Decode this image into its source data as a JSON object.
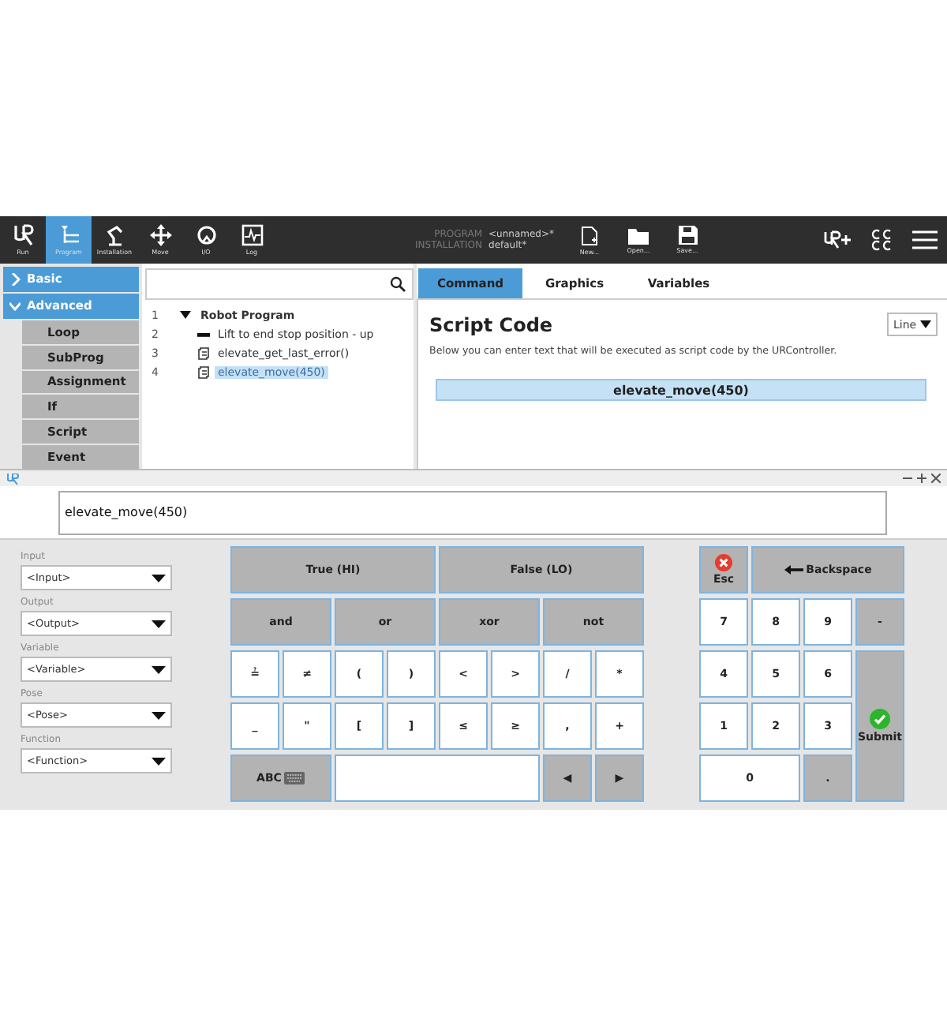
{
  "toolbar": {
    "nav": [
      {
        "label": "Run",
        "kind": "logo",
        "selected": false
      },
      {
        "label": "Program",
        "kind": "program",
        "selected": true
      },
      {
        "label": "Installation",
        "kind": "arm",
        "selected": false
      },
      {
        "label": "Move",
        "kind": "move",
        "selected": false
      },
      {
        "label": "I/O",
        "kind": "io",
        "selected": false
      },
      {
        "label": "Log",
        "kind": "log",
        "selected": false
      }
    ],
    "program": {
      "label": "PROGRAM",
      "value": "<unnamed>*"
    },
    "installation": {
      "label": "INSTALLATION",
      "value": "default*"
    },
    "file_buttons": [
      {
        "label": "New...",
        "kind": "new"
      },
      {
        "label": "Open...",
        "kind": "open"
      },
      {
        "label": "Save...",
        "kind": "save"
      }
    ]
  },
  "sidebar": {
    "sections": [
      {
        "label": "Basic",
        "expanded": false
      },
      {
        "label": "Advanced",
        "expanded": true,
        "items": [
          "Loop",
          "SubProg",
          "Assignment",
          "If",
          "Script",
          "Event"
        ]
      }
    ]
  },
  "tree": {
    "nodes": [
      {
        "number": "1",
        "label": "Robot Program",
        "kind": "root",
        "expanded": true,
        "selected": false,
        "children": [
          {
            "number": "2",
            "label": "Lift to end stop position - up",
            "kind": "bar",
            "selected": false
          },
          {
            "number": "3",
            "label": "elevate_get_last_error()",
            "kind": "script",
            "selected": false
          },
          {
            "number": "4",
            "label": "elevate_move(450)",
            "kind": "script",
            "selected": true
          }
        ]
      }
    ]
  },
  "command_panel": {
    "tabs": [
      {
        "label": "Command",
        "selected": true
      },
      {
        "label": "Graphics",
        "selected": false
      },
      {
        "label": "Variables",
        "selected": false
      }
    ],
    "title": "Script Code",
    "mode": "Line",
    "description": "Below you can enter text that will be executed as script code by the URController.",
    "code_line": "elevate_move(450)"
  },
  "dialog": {
    "expression": "elevate_move(450)",
    "selectors": [
      {
        "label": "Input",
        "value": "<Input>"
      },
      {
        "label": "Output",
        "value": "<Output>"
      },
      {
        "label": "Variable",
        "value": "<Variable>"
      },
      {
        "label": "Pose",
        "value": "<Pose>"
      },
      {
        "label": "Function",
        "value": "<Function>"
      }
    ],
    "keypad": [
      [
        {
          "label": "True (HI)",
          "kind": "value"
        },
        {
          "label": "False (LO)",
          "kind": "value"
        }
      ],
      [
        {
          "label": "and",
          "kind": "logic"
        },
        {
          "label": "or",
          "kind": "logic"
        },
        {
          "label": "xor",
          "kind": "logic"
        },
        {
          "label": "not",
          "kind": "logic"
        }
      ],
      [
        {
          "label": "≟",
          "kind": "symbol"
        },
        {
          "label": "≠",
          "kind": "symbol"
        },
        {
          "label": "(",
          "kind": "symbol"
        },
        {
          "label": ")",
          "kind": "symbol"
        },
        {
          "label": "<",
          "kind": "symbol"
        },
        {
          "label": ">",
          "kind": "symbol"
        },
        {
          "label": "/",
          "kind": "symbol"
        },
        {
          "label": "*",
          "kind": "symbol"
        }
      ],
      [
        {
          "label": "_",
          "kind": "symbol"
        },
        {
          "label": "\"",
          "kind": "symbol"
        },
        {
          "label": "[",
          "kind": "symbol"
        },
        {
          "label": "]",
          "kind": "symbol"
        },
        {
          "label": "≤",
          "kind": "symbol"
        },
        {
          "label": "≥",
          "kind": "symbol"
        },
        {
          "label": ",",
          "kind": "symbol"
        },
        {
          "label": "+",
          "kind": "symbol"
        }
      ],
      [
        {
          "label": "ABC",
          "kind": "abc"
        },
        {
          "kind": "space"
        },
        {
          "label": "◀",
          "kind": "arrow"
        },
        {
          "label": "▶",
          "kind": "arrow"
        }
      ]
    ],
    "numpad": [
      {
        "label": "Esc",
        "kind": "esc"
      },
      {
        "label": "Backspace",
        "kind": "backspace"
      },
      {
        "label": "7",
        "kind": "digit"
      },
      {
        "label": "8",
        "kind": "digit"
      },
      {
        "label": "9",
        "kind": "digit"
      },
      {
        "label": "-",
        "kind": "sign"
      },
      {
        "label": "4",
        "kind": "digit"
      },
      {
        "label": "5",
        "kind": "digit"
      },
      {
        "label": "6",
        "kind": "digit"
      },
      {
        "label": "Submit",
        "kind": "submit"
      },
      {
        "label": "1",
        "kind": "digit"
      },
      {
        "label": "2",
        "kind": "digit"
      },
      {
        "label": "3",
        "kind": "digit"
      },
      {
        "label": "0",
        "kind": "zero"
      },
      {
        "label": ".",
        "kind": "sign"
      }
    ]
  }
}
